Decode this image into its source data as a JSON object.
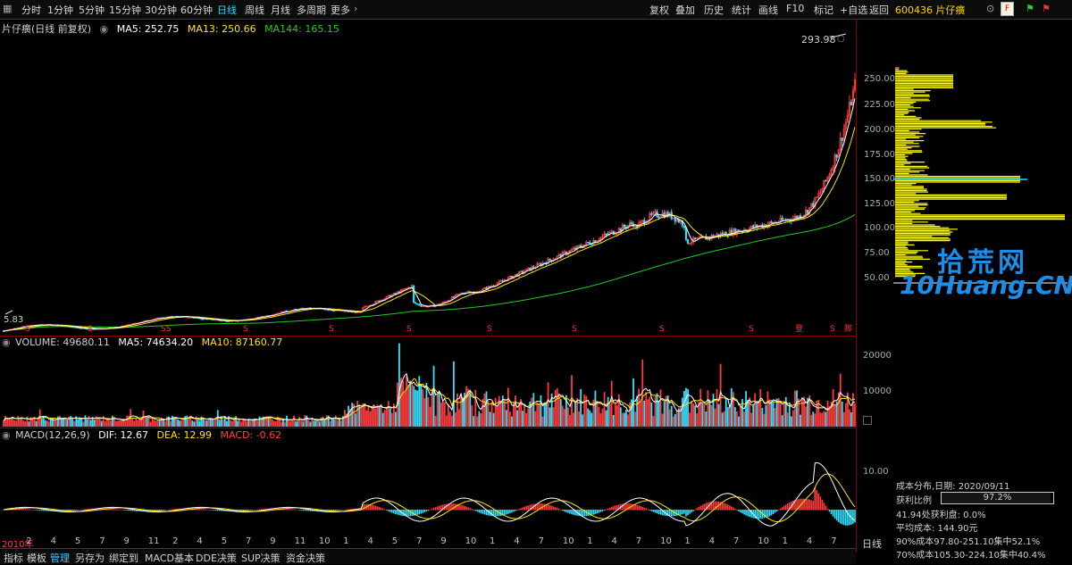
{
  "toolbar": {
    "periods": [
      "分时",
      "1分钟",
      "5分钟",
      "15分钟",
      "30分钟",
      "60分钟",
      "日线",
      "周线",
      "月线",
      "多周期",
      "更多"
    ],
    "active_period": "日线",
    "tools": [
      "复权",
      "叠加",
      "历史",
      "统计",
      "画线",
      "F10",
      "标记",
      "+自选",
      "返回"
    ],
    "stock_code_name": "600436 片仔癀"
  },
  "main_panel": {
    "stock_title": "片仔癀(日线 前复权)",
    "ma5": "MA5: 252.75",
    "ma13": "MA13: 250.66",
    "ma144": "MA144: 165.15",
    "high_marker": "293.98",
    "low_marker": "5.83",
    "right_axis": [
      "250.00",
      "225.00",
      "200.00",
      "175.00",
      "150.00",
      "125.00",
      "100.00",
      "75.00",
      "50.00"
    ],
    "event_marks": [
      "S",
      "S",
      "SS",
      "S",
      "S",
      "S",
      "S",
      "S",
      "S",
      "S",
      "登",
      "S",
      "脚"
    ],
    "colors": {
      "up": "#ff3c3c",
      "down": "#33e0ff",
      "ma5": "#ffffff",
      "ma13": "#ffe600",
      "ma144": "#22cc22"
    }
  },
  "volume_panel": {
    "label": "VOLUME: 49680.11",
    "ma5": "MA5: 74634.20",
    "ma10": "MA10: 87160.77",
    "right_axis": [
      "20000",
      "10000"
    ]
  },
  "macd_panel": {
    "label": "MACD(12,26,9)",
    "dif": "DIF: 12.67",
    "dea": "DEA: 12.99",
    "macd": "MACD: -0.62",
    "right_axis": [
      "10.00"
    ]
  },
  "x_axis_labels": [
    "2010年",
    "2",
    "4",
    "5",
    "7",
    "9",
    "11",
    "2",
    "4",
    "5",
    "7",
    "9",
    "11",
    "10",
    "1",
    "4",
    "5",
    "7",
    "9",
    "10",
    "1",
    "4",
    "7",
    "10",
    "1",
    "4",
    "7",
    "10",
    "1",
    "4",
    "7",
    "10",
    "1",
    "4",
    "7"
  ],
  "right_panel": {
    "header_icons": [
      "window-icon",
      "f-icon",
      "flag-icon",
      "red-flag-icon"
    ],
    "cost_title": "成本分布,日期:",
    "cost_date": "2020/09/11",
    "profit_ratio_label": "获利比例",
    "profit_ratio_value": "97.2%",
    "profit_ratio": 0.972,
    "profit_line": "41.94处获利盘: 0.0%",
    "avg_cost": "平均成本: 144.90元",
    "cost90": "90%成本97.80-251.10集中52.1%",
    "cost70": "70%成本105.30-224.10集中40.4%",
    "period_tab": "日线",
    "logo_text": "拾荒网",
    "logo_sub": "10Huang.CN"
  },
  "bottom_tabs": [
    "指标",
    "模板",
    "管理",
    "另存为",
    "绑定到",
    "MACD基本",
    "DDE决策",
    "SUP决策",
    "资金决策"
  ],
  "active_bottom_tab": "管理"
}
